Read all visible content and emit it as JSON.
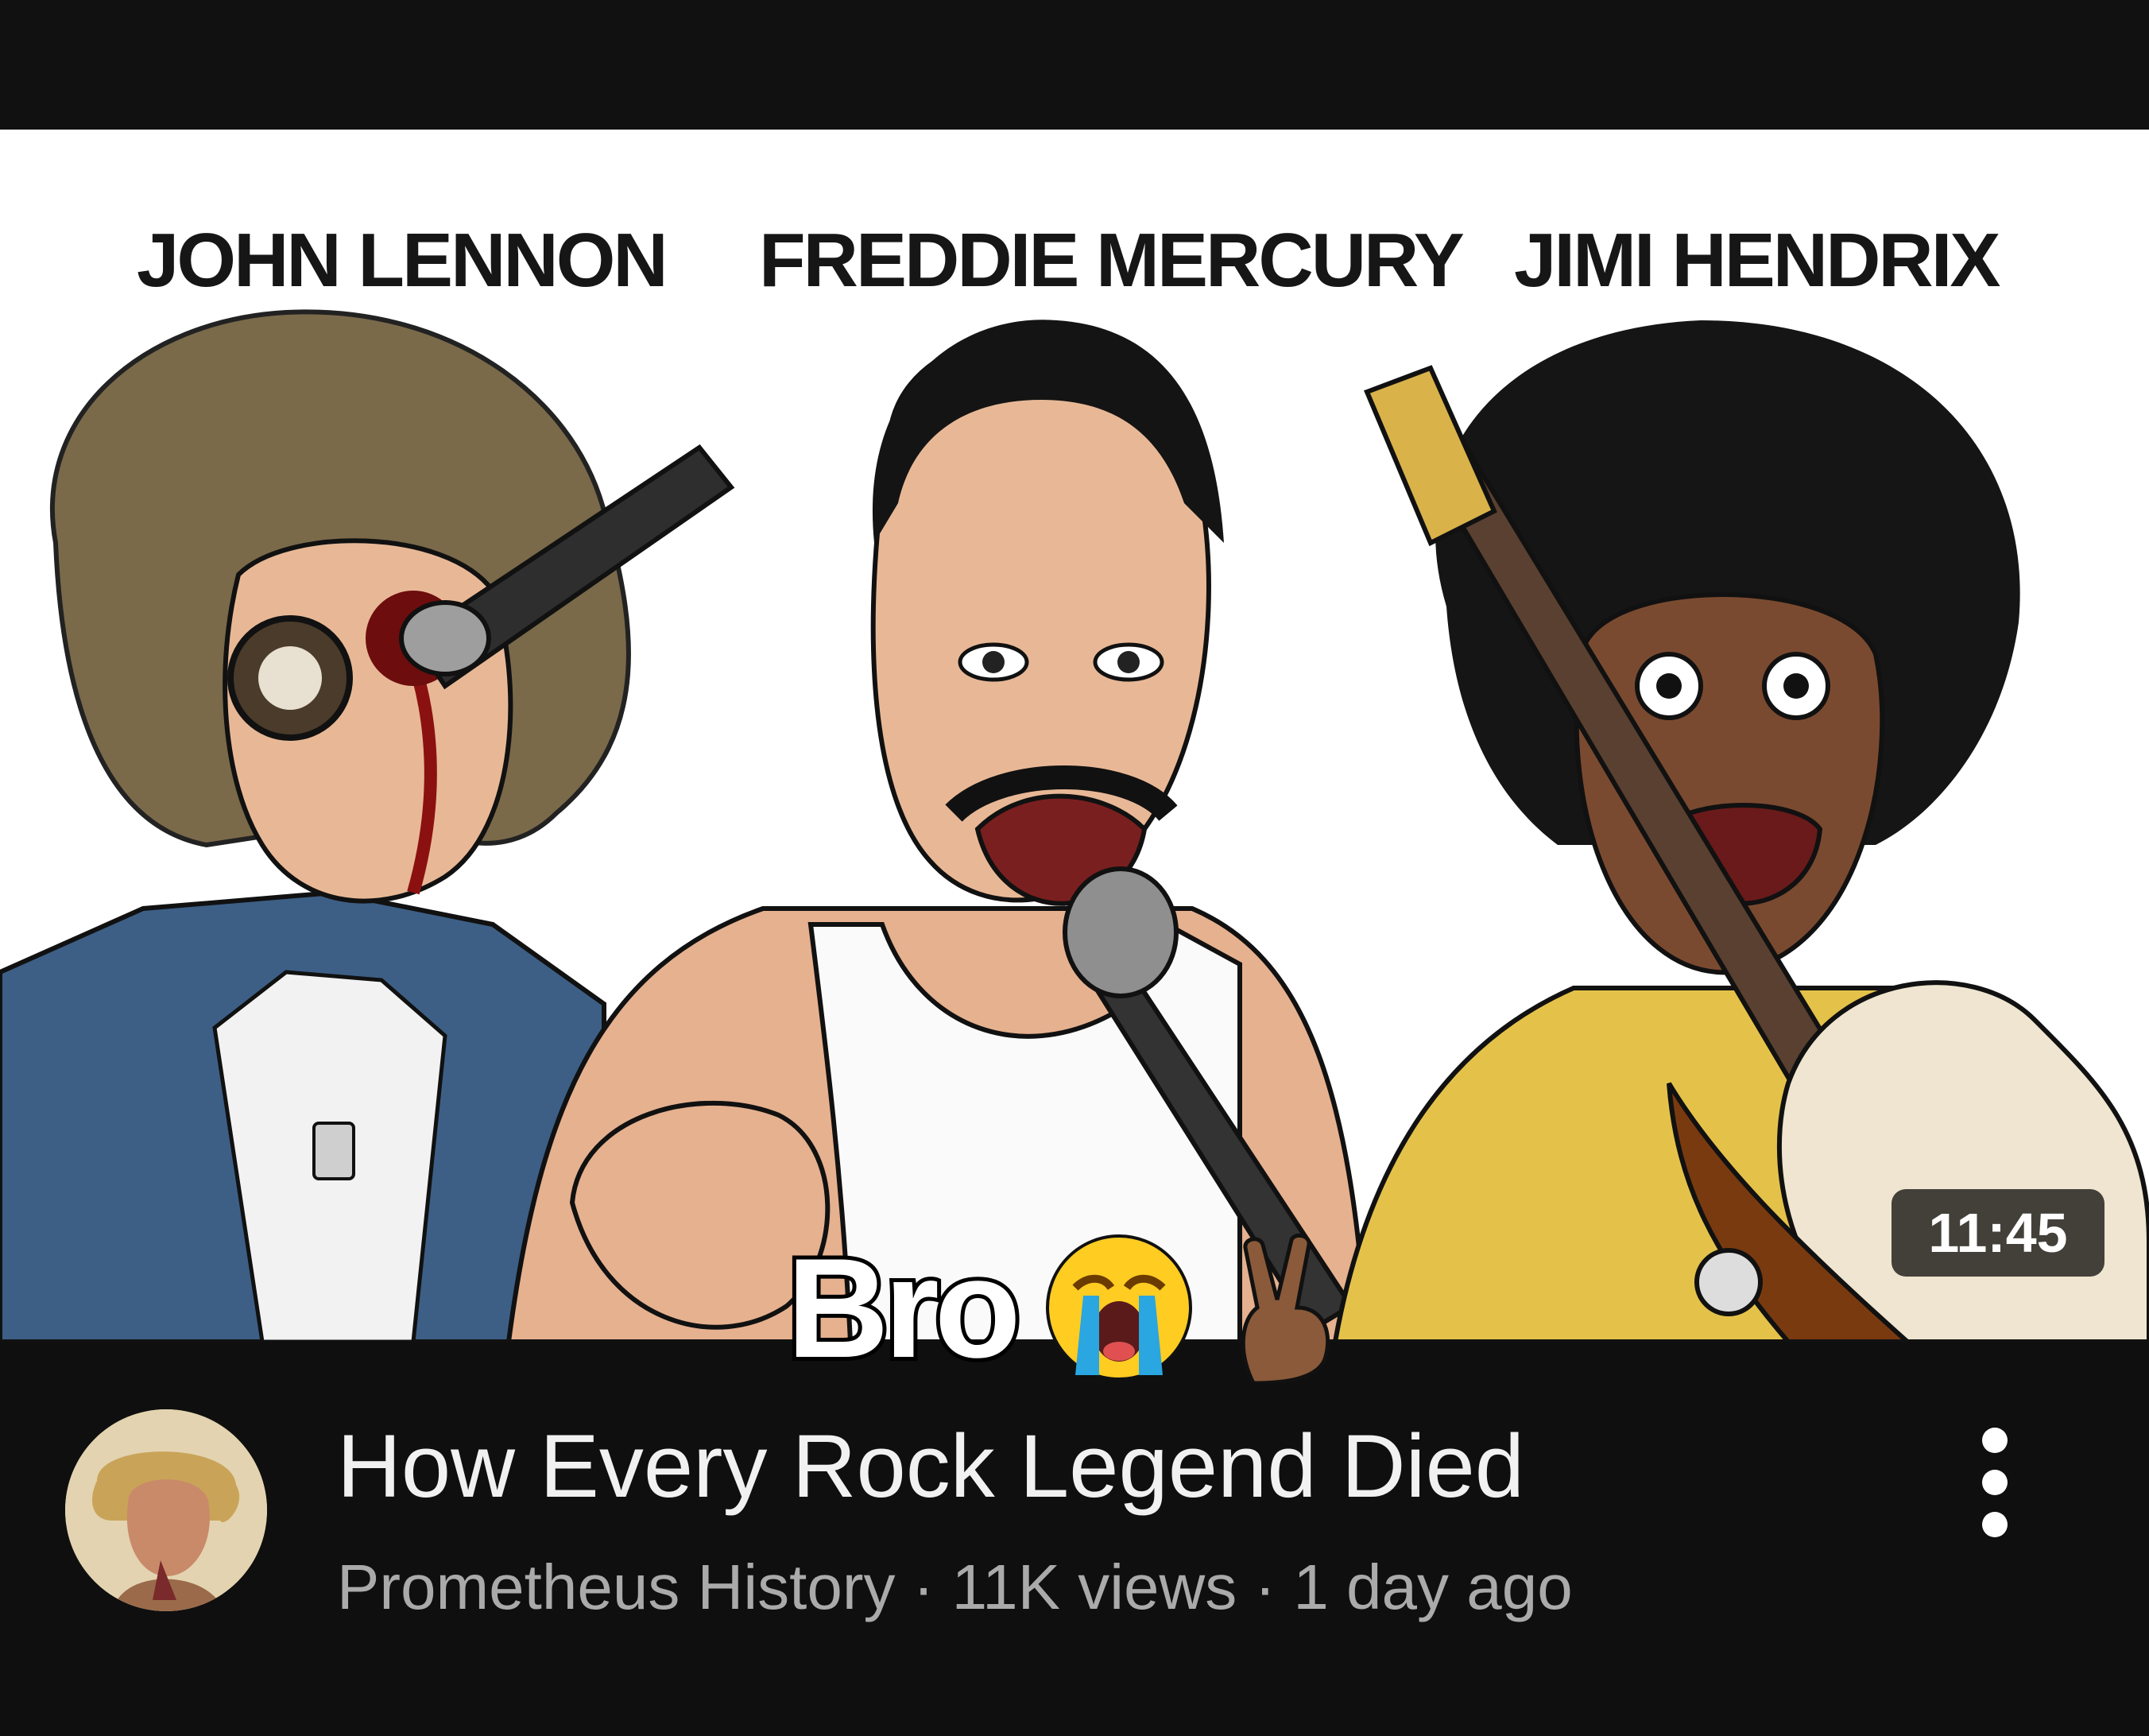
{
  "video": {
    "thumbnail_names": [
      "JOHN LENNON",
      "FREDDIE MERCURY",
      "JIMI HENDRIX"
    ],
    "duration": "11:45",
    "caption": {
      "text": "Bro",
      "emojis": [
        "loudly-crying-face",
        "victory-hand-medium-dark-skin"
      ]
    },
    "title": "How Every Rock Legend Died",
    "meta": {
      "channel": "Prometheus History",
      "views": "11K views",
      "age": "1 day ago",
      "separator": " · "
    },
    "more_icon": "vertical-ellipsis-icon"
  }
}
